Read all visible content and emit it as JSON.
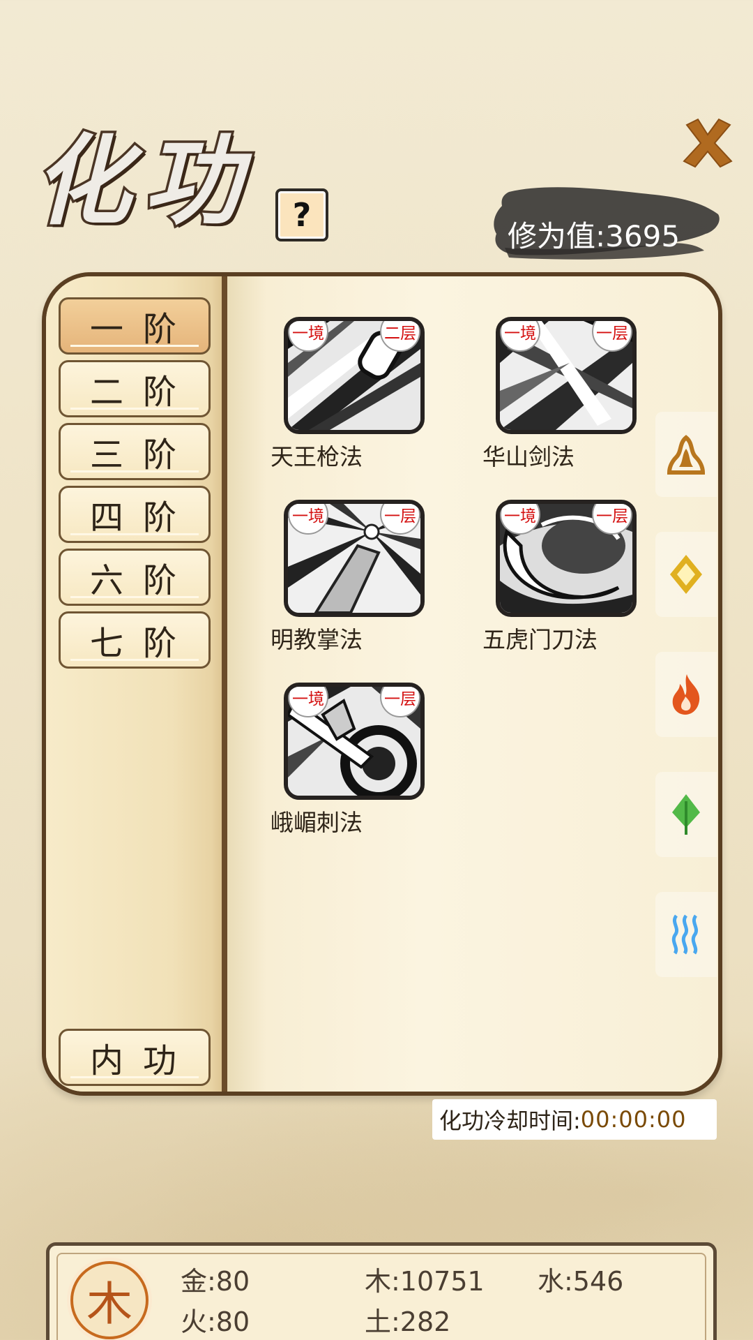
{
  "header": {
    "title": "化功",
    "help_label": "?",
    "xiuwei_label": "修为值:3695"
  },
  "tiers": [
    {
      "label": "一阶",
      "active": true
    },
    {
      "label": "二阶",
      "active": false
    },
    {
      "label": "三阶",
      "active": false
    },
    {
      "label": "四阶",
      "active": false
    },
    {
      "label": "六阶",
      "active": false
    },
    {
      "label": "七阶",
      "active": false
    }
  ],
  "neigong_label": "内功",
  "skills": [
    {
      "name": "天王枪法",
      "realm": "一境",
      "layer": "二层",
      "icon": "spear-thrust-icon"
    },
    {
      "name": "华山剑法",
      "realm": "一境",
      "layer": "一层",
      "icon": "sword-slash-icon"
    },
    {
      "name": "明教掌法",
      "realm": "一境",
      "layer": "一层",
      "icon": "palm-strike-icon"
    },
    {
      "name": "五虎门刀法",
      "realm": "一境",
      "layer": "一层",
      "icon": "blade-swirl-icon"
    },
    {
      "name": "峨嵋刺法",
      "realm": "一境",
      "layer": "一层",
      "icon": "dagger-pierce-icon"
    }
  ],
  "element_tabs": [
    {
      "name": "earth",
      "icon": "earth-mountain-icon",
      "color": "#b8761e"
    },
    {
      "name": "metal",
      "icon": "metal-diamond-icon",
      "color": "#e0b020"
    },
    {
      "name": "fire",
      "icon": "fire-flame-icon",
      "color": "#e3561d"
    },
    {
      "name": "wood",
      "icon": "wood-leaf-icon",
      "color": "#52b948"
    },
    {
      "name": "water",
      "icon": "water-wave-icon",
      "color": "#49a7ef"
    }
  ],
  "cooldown": {
    "label": "化功冷却时间:",
    "value": "00:00:00"
  },
  "resources": {
    "current_element": "木",
    "jin": "金:80",
    "mu": "木:10751",
    "shui": "水:546",
    "huo": "火:80",
    "tu": "土:282"
  }
}
